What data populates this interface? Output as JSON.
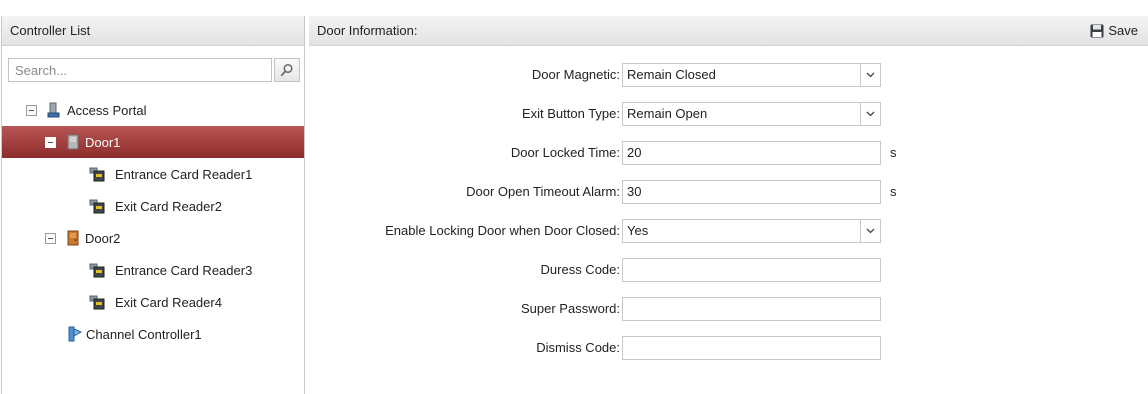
{
  "left_panel": {
    "title": "Controller List",
    "search": {
      "placeholder": "Search...",
      "value": ""
    },
    "tree": {
      "access_portal": "Access Portal",
      "door1": "Door1",
      "door1_readers": [
        "Entrance Card Reader1",
        "Exit Card Reader2"
      ],
      "door2": "Door2",
      "door2_readers": [
        "Entrance Card Reader3",
        "Exit Card Reader4"
      ],
      "channel_controller": "Channel Controller1"
    }
  },
  "right_panel": {
    "title": "Door Information:",
    "save_label": "Save",
    "fields": {
      "door_magnetic": {
        "label": "Door Magnetic:",
        "value": "Remain Closed"
      },
      "exit_button_type": {
        "label": "Exit Button Type:",
        "value": "Remain Open"
      },
      "door_locked_time": {
        "label": "Door Locked Time:",
        "value": "20",
        "unit": "s"
      },
      "door_open_timeout_alarm": {
        "label": "Door Open Timeout Alarm:",
        "value": "30",
        "unit": "s"
      },
      "enable_locking": {
        "label": "Enable Locking Door when Door Closed:",
        "value": "Yes"
      },
      "duress_code": {
        "label": "Duress Code:",
        "value": ""
      },
      "super_password": {
        "label": "Super Password:",
        "value": ""
      },
      "dismiss_code": {
        "label": "Dismiss Code:",
        "value": ""
      }
    }
  },
  "colors": {
    "selected_row": "#a03c3c",
    "header_bg": "#e6e6e6",
    "border": "#c8c8c8"
  },
  "icons": [
    "search-icon",
    "save-icon",
    "access-portal-icon",
    "door-icon",
    "card-reader-icon",
    "channel-controller-icon",
    "collapse-toggle-icon",
    "chevron-down-icon"
  ]
}
